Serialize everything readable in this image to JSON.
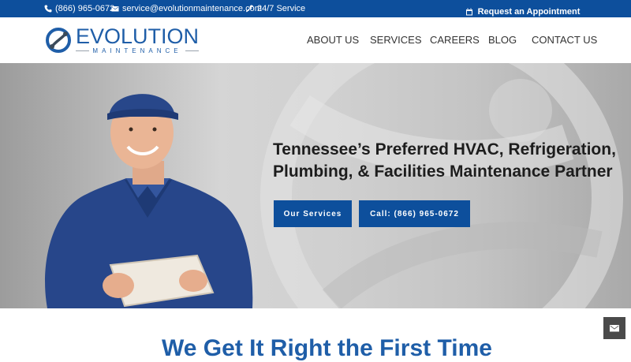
{
  "topbar": {
    "phone": "(866) 965-0672",
    "email": "service@evolutionmaintenance.com",
    "service": "24/7 Service",
    "appointment_label": "Request an Appointment"
  },
  "logo": {
    "name": "EVOLUTION",
    "tagline": "MAINTENANCE"
  },
  "nav": {
    "items": [
      "ABOUT US",
      "SERVICES",
      "CAREERS",
      "BLOG",
      "CONTACT US"
    ]
  },
  "hero": {
    "headline_line1": "Tennessee’s Preferred HVAC, Refrigeration,",
    "headline_line2": "Plumbing, & Facilities Maintenance Partner",
    "btn_services": "Our Services",
    "btn_call": "Call: (866) 965-0672"
  },
  "section": {
    "title_partial": "We Get It Right the First Time"
  },
  "colors": {
    "brand_blue": "#0d4f9c",
    "logo_blue": "#1f5ea8"
  },
  "icons": [
    "phone-icon",
    "envelope-icon",
    "wrench-icon",
    "calendar-icon",
    "mail-icon"
  ]
}
